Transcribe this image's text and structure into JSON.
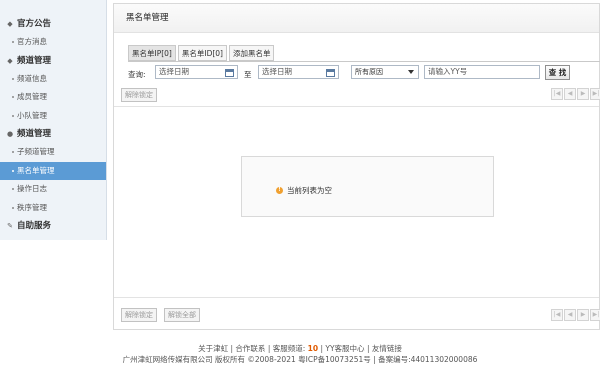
{
  "sidebar": {
    "sections": [
      {
        "title": "官方公告",
        "icon": "chevron-down-icon",
        "items": [
          {
            "label": "官方消息"
          }
        ]
      },
      {
        "title": "频道管理",
        "icon": "chevron-down-icon",
        "items": [
          {
            "label": "频道信息"
          },
          {
            "label": "成员管理"
          },
          {
            "label": "小队管理"
          }
        ]
      },
      {
        "title": "频道管理",
        "icon": "location-pin-icon",
        "items": [
          {
            "label": "子频道管理"
          },
          {
            "label": "黑名单管理"
          },
          {
            "label": "操作日志"
          },
          {
            "label": "秩序管理"
          }
        ]
      },
      {
        "title": "自助服务",
        "icon": "wrench-icon",
        "items": []
      }
    ],
    "active_item": "黑名单管理"
  },
  "main": {
    "title": "黑名单管理",
    "tabs": [
      {
        "label": "黑名单IP[0]"
      },
      {
        "label": "黑名单ID[0]"
      },
      {
        "label": "添加黑名单"
      }
    ],
    "query": {
      "label": "查询:",
      "start_date_placeholder": "选择日期",
      "separator": "至",
      "end_date_placeholder": "选择日期",
      "reason_selected": "所有原因",
      "yy_placeholder": "请输入YY号",
      "search_button": "查 找"
    },
    "unlock_top": "解除锁定",
    "empty_message": "当前列表为空",
    "unlock_bottom": "解除锁定",
    "unlock_all": "解锁全部",
    "pager": {
      "first": "|◀",
      "prev": "◀",
      "next": "▶",
      "last": "▶|"
    }
  },
  "footer": {
    "line1_pre": "关于津虹 | 合作联系 | 客服频道:",
    "line1_channel": "10",
    "line1_post": "| YY客服中心 | 友情链接",
    "line2": "广州津虹网络传媒有限公司 版权所有 ©2008-2021 粤ICP备10073251号 | 备案编号:44011302000086"
  },
  "colors": {
    "active_bg": "#5b9bd5",
    "channel_highlight": "#e05a00"
  }
}
